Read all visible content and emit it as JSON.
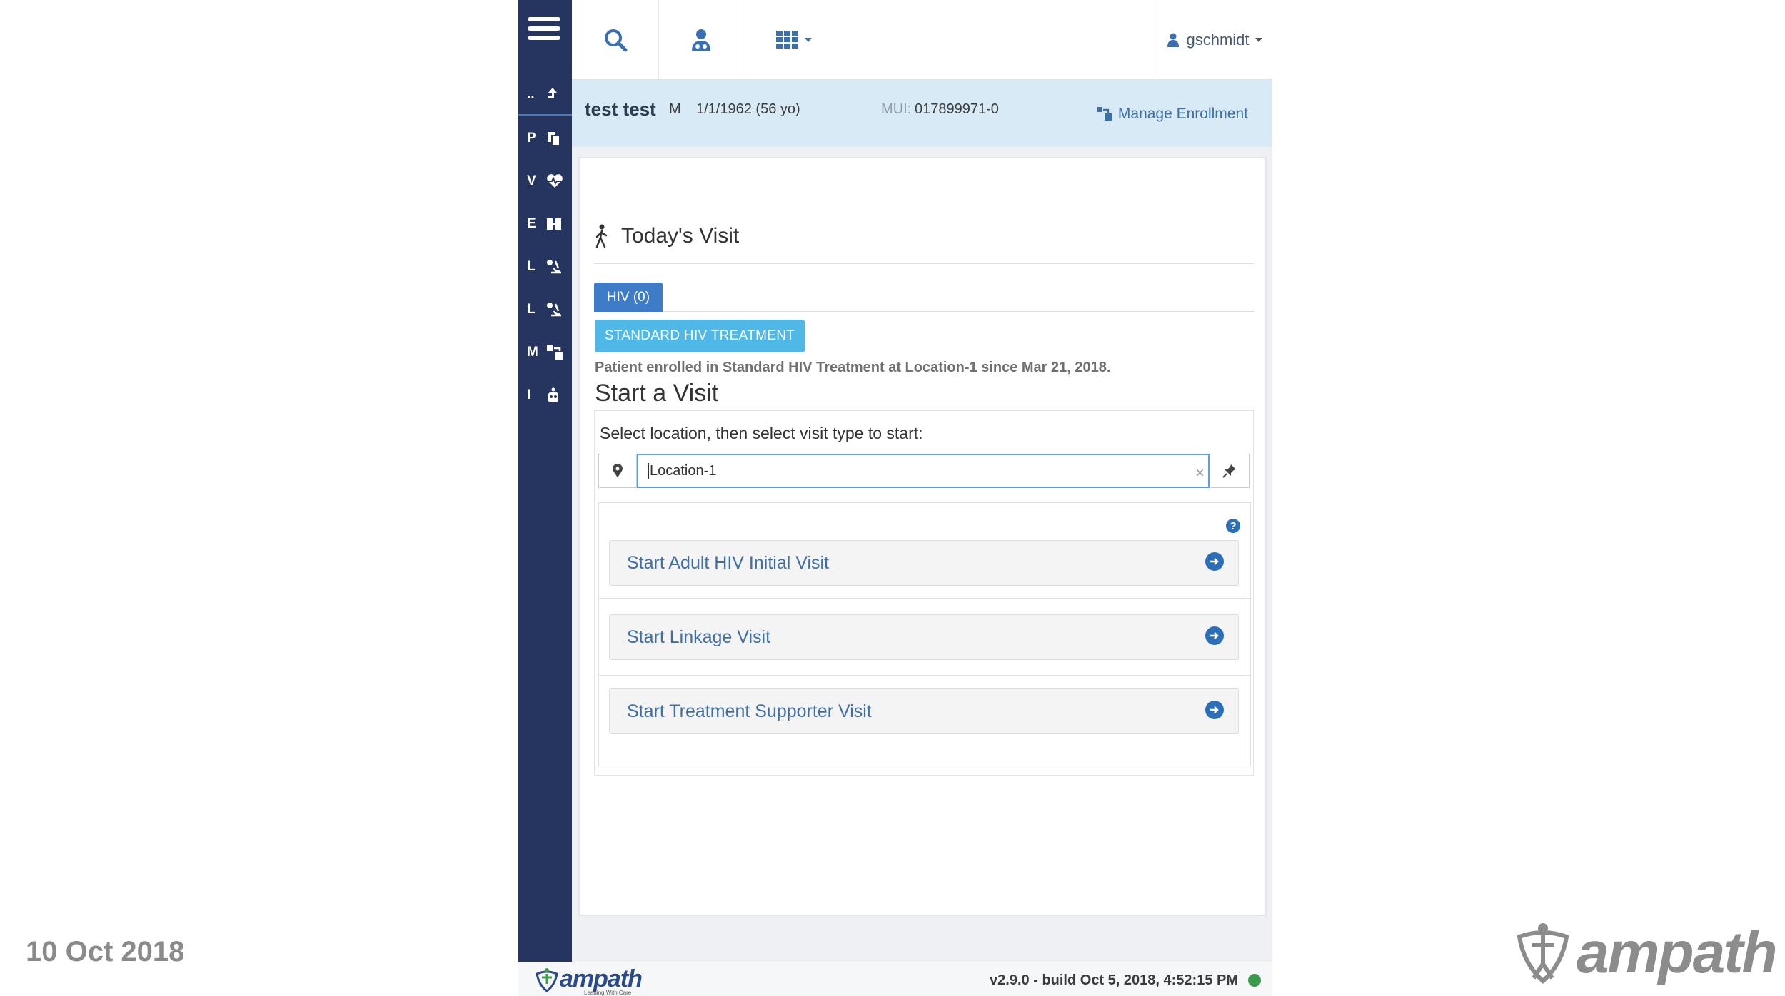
{
  "slide": {
    "date": "10 Oct 2018",
    "brand": "ampath"
  },
  "sidebar": {
    "items": [
      {
        "letter": "..",
        "icon": "up-arrow-icon"
      },
      {
        "letter": "P",
        "icon": "documents-icon"
      },
      {
        "letter": "V",
        "icon": "heart-pulse-icon"
      },
      {
        "letter": "E",
        "icon": "people-icon"
      },
      {
        "letter": "L",
        "icon": "microscope-icon"
      },
      {
        "letter": "L",
        "icon": "microscope-icon"
      },
      {
        "letter": "M",
        "icon": "transfer-icon"
      },
      {
        "letter": "I",
        "icon": "robot-icon"
      }
    ]
  },
  "topnav": {
    "username": "gschmidt"
  },
  "patient": {
    "name": "test test",
    "gender": "M",
    "dob": "1/1/1962 (56 yo)",
    "mui_label": "MUI:",
    "mui": "017899971-0",
    "manage_enrollment": "Manage Enrollment"
  },
  "visit": {
    "title": "Today's Visit",
    "tab_label": "HIV (0)",
    "program_button": "STANDARD HIV TREATMENT",
    "enrolled_text": "Patient enrolled in Standard HIV Treatment at Location-1 since Mar 21, 2018.",
    "start_title": "Start a Visit",
    "select_label": "Select location, then select visit type to start:",
    "location_value": "Location-1",
    "visit_types": [
      "Start Adult HIV Initial Visit",
      "Start Linkage Visit",
      "Start Treatment Supporter Visit"
    ]
  },
  "footer": {
    "logo": "ampath",
    "tagline": "Leading With Care",
    "version": "v2.9.0 - build Oct 5, 2018, 4:52:15 PM"
  },
  "colors": {
    "sidebar": "#253560",
    "primary": "#3f7cc8",
    "program": "#4fb8e6",
    "link": "#3f6fa5",
    "status_ok": "#3a9a4a"
  }
}
